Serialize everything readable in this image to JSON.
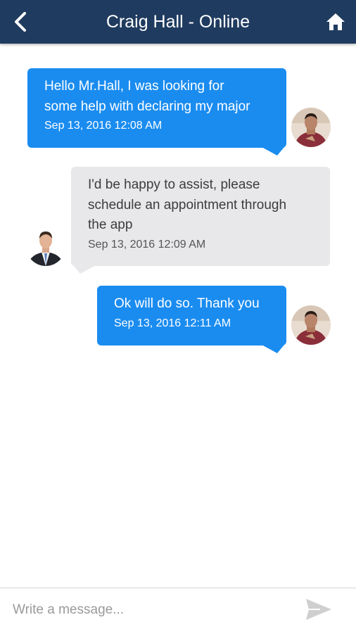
{
  "header": {
    "title": "Craig Hall - Online",
    "back_icon": "chevron-left-icon",
    "home_icon": "home-icon",
    "background_color": "#1f3b5f"
  },
  "messages": [
    {
      "direction": "outgoing",
      "text": "Hello Mr.Hall, I was looking for\nsome help with declaring my major",
      "timestamp": "Sep 13, 2016 12:08 AM"
    },
    {
      "direction": "incoming",
      "text": "I'd be happy to assist, please\nschedule an appointment through\nthe app",
      "timestamp": "Sep 13, 2016 12:09 AM"
    },
    {
      "direction": "outgoing",
      "text": "Ok will do so. Thank you",
      "timestamp": "Sep 13, 2016 12:11 AM"
    }
  ],
  "colors": {
    "outgoing_bubble": "#1a8cf0",
    "incoming_bubble": "#e8e8eb"
  },
  "composer": {
    "placeholder": "Write a message...",
    "value": "",
    "send_icon": "send-icon"
  }
}
